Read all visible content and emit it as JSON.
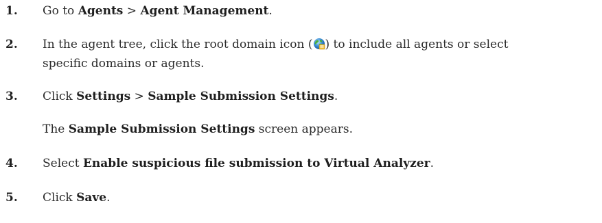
{
  "steps": [
    {
      "number": "1.",
      "parts": [
        "Go to ",
        "Agents",
        " > ",
        "Agent Management",
        "."
      ]
    },
    {
      "number": "2.",
      "line1_before_icon": "In the agent tree, click the root domain icon (",
      "line1_after_icon": ") to include all agents or select",
      "line2": "specific domains or agents."
    },
    {
      "number": "3.",
      "parts": [
        "Click ",
        "Settings",
        " > ",
        "Sample Submission Settings",
        "."
      ]
    },
    {
      "parts": [
        "The ",
        "Sample Submission Settings",
        " screen appears."
      ]
    },
    {
      "number": "4.",
      "parts": [
        "Select ",
        "Enable suspicious file submission to Virtual Analyzer",
        "."
      ]
    },
    {
      "number": "5.",
      "parts": [
        "Click ",
        "Save",
        "."
      ]
    }
  ],
  "icons": {
    "root_domain": "root-domain-globe-icon"
  }
}
